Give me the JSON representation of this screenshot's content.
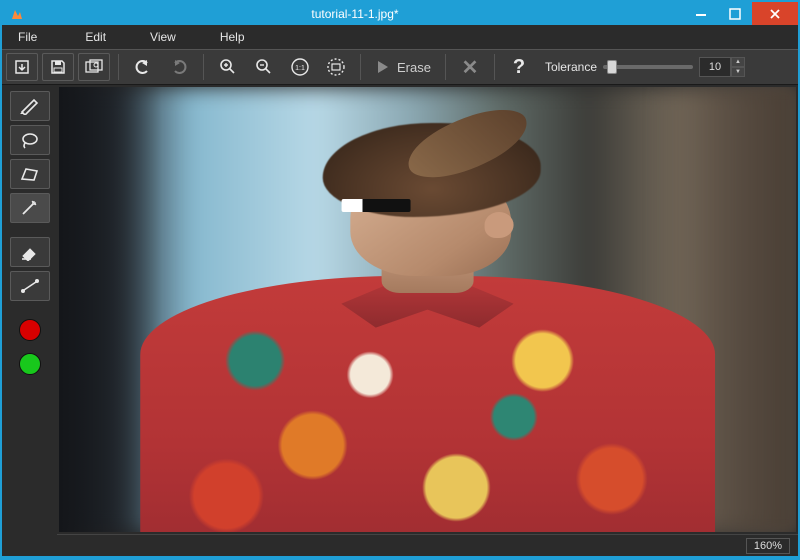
{
  "window": {
    "title": "tutorial-11-1.jpg*"
  },
  "menu": {
    "file": "File",
    "edit": "Edit",
    "view": "View",
    "help": "Help"
  },
  "toolbar": {
    "erase_label": "Erase",
    "tolerance_label": "Tolerance",
    "tolerance_value": "10"
  },
  "status": {
    "zoom": "160%"
  },
  "icons": {
    "app": "app-icon",
    "minimize": "minimize-icon",
    "maximize": "maximize-icon",
    "close": "close-icon",
    "open": "open-file-icon",
    "save": "save-icon",
    "screenshot": "screenshot-icon",
    "undo": "undo-icon",
    "redo": "redo-icon",
    "zoom_in": "zoom-in-icon",
    "zoom_out": "zoom-out-icon",
    "zoom_11": "zoom-1to1-icon",
    "zoom_fit": "zoom-fit-icon",
    "play": "play-icon",
    "cancel": "cancel-icon",
    "help": "help-icon",
    "marker": "marker-tool-icon",
    "lasso": "lasso-tool-icon",
    "polygon": "polygon-tool-icon",
    "magic": "magic-wand-icon",
    "eraser": "eraser-tool-icon",
    "line": "line-tool-icon",
    "fg_color": "foreground-color-icon",
    "bg_color": "background-color-icon"
  }
}
